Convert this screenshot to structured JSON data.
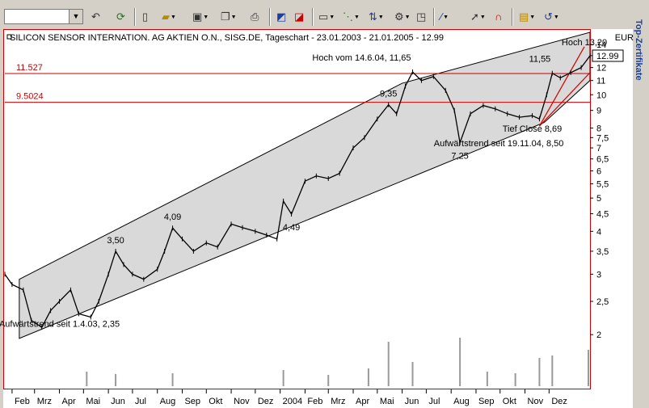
{
  "toolbar": {
    "symbol_value": "",
    "icons": [
      "back-icon",
      "refresh-icon",
      "new-document-icon",
      "open-folder-icon",
      "save-icon",
      "copy-icon",
      "print-icon",
      "chart-link-icon",
      "chart-export-icon",
      "window-icon",
      "indicator-icon",
      "compare-icon",
      "settings-icon",
      "line-tool-icon",
      "cursor-icon",
      "magnet-icon",
      "info-icon",
      "undo-icon"
    ]
  },
  "side_tab": {
    "label": "Top-Zertifikate"
  },
  "chart_data": {
    "type": "line",
    "title": "SILICON SENSOR INTERNATION. AG AKTIEN O.N., SISG.DE, Tageschart - 23.01.2003 - 21.01.2005 - 12.99",
    "currency": "EUR",
    "last_price_label": "12.99",
    "y_scale": "log",
    "ylim": [
      1.4,
      15.2
    ],
    "y_ticks": [
      "14",
      "13",
      "12",
      "11",
      "10",
      "9",
      "8",
      "7,5",
      "7",
      "6,5",
      "6",
      "5,5",
      "5",
      "4,5",
      "4",
      "3,5",
      "3",
      "2,5",
      "2"
    ],
    "x_range": [
      "2003-01-23",
      "2005-01-21"
    ],
    "x_tick_labels": [
      {
        "date": "2003-02-01",
        "label": "Feb"
      },
      {
        "date": "2003-03-01",
        "label": "Mrz"
      },
      {
        "date": "2003-04-01",
        "label": "Apr"
      },
      {
        "date": "2003-05-01",
        "label": "Mai"
      },
      {
        "date": "2003-06-01",
        "label": "Jun"
      },
      {
        "date": "2003-07-01",
        "label": "Jul"
      },
      {
        "date": "2003-08-01",
        "label": "Aug"
      },
      {
        "date": "2003-09-01",
        "label": "Sep"
      },
      {
        "date": "2003-10-01",
        "label": "Okt"
      },
      {
        "date": "2003-11-01",
        "label": "Nov"
      },
      {
        "date": "2003-12-01",
        "label": "Dez"
      },
      {
        "date": "2004-01-01",
        "label": "2004"
      },
      {
        "date": "2004-02-01",
        "label": "Feb"
      },
      {
        "date": "2004-03-01",
        "label": "Mrz"
      },
      {
        "date": "2004-04-01",
        "label": "Apr"
      },
      {
        "date": "2004-05-01",
        "label": "Mai"
      },
      {
        "date": "2004-06-01",
        "label": "Jun"
      },
      {
        "date": "2004-07-01",
        "label": "Jul"
      },
      {
        "date": "2004-08-01",
        "label": "Aug"
      },
      {
        "date": "2004-09-01",
        "label": "Sep"
      },
      {
        "date": "2004-10-01",
        "label": "Okt"
      },
      {
        "date": "2004-11-01",
        "label": "Nov"
      },
      {
        "date": "2004-12-01",
        "label": "Dez"
      }
    ],
    "horizontal_lines": [
      {
        "value": 11.527,
        "label": "11.527",
        "color": "#cc0000"
      },
      {
        "value": 9.5024,
        "label": "9.5024",
        "color": "#cc0000"
      }
    ],
    "trend_channel": {
      "lower": [
        {
          "date": "2003-02-10",
          "value": 1.95
        },
        {
          "date": "2004-11-25",
          "value": 8.3
        },
        {
          "date": "2005-01-21",
          "value": 11.0
        }
      ],
      "upper": [
        {
          "date": "2003-02-10",
          "value": 2.9
        },
        {
          "date": "2004-06-01",
          "value": 10.8
        },
        {
          "date": "2005-01-21",
          "value": 15.2
        }
      ],
      "fill": "#d9d9d9"
    },
    "red_trend_lines": [
      {
        "from": {
          "date": "2004-11-19",
          "value": 8.1
        },
        "to": {
          "date": "2005-01-14",
          "value": 13.8
        }
      },
      {
        "from": {
          "date": "2004-11-19",
          "value": 8.1
        },
        "to": {
          "date": "2005-01-21",
          "value": 11.6
        }
      }
    ],
    "series": [
      {
        "color": "#000000",
        "points": [
          {
            "date": "2003-01-23",
            "value": 3.0
          },
          {
            "date": "2003-02-01",
            "value": 2.8
          },
          {
            "date": "2003-02-15",
            "value": 2.7
          },
          {
            "date": "2003-02-25",
            "value": 2.2
          },
          {
            "date": "2003-03-10",
            "value": 2.1
          },
          {
            "date": "2003-03-21",
            "value": 2.35
          },
          {
            "date": "2003-04-01",
            "value": 2.5
          },
          {
            "date": "2003-04-15",
            "value": 2.7
          },
          {
            "date": "2003-04-25",
            "value": 2.3
          },
          {
            "date": "2003-05-10",
            "value": 2.25
          },
          {
            "date": "2003-05-20",
            "value": 2.5
          },
          {
            "date": "2003-06-01",
            "value": 3.0
          },
          {
            "date": "2003-06-10",
            "value": 3.5
          },
          {
            "date": "2003-06-20",
            "value": 3.2
          },
          {
            "date": "2003-07-01",
            "value": 3.0
          },
          {
            "date": "2003-07-15",
            "value": 2.9
          },
          {
            "date": "2003-08-01",
            "value": 3.1
          },
          {
            "date": "2003-08-10",
            "value": 3.5
          },
          {
            "date": "2003-08-20",
            "value": 4.09
          },
          {
            "date": "2003-09-01",
            "value": 3.8
          },
          {
            "date": "2003-09-15",
            "value": 3.5
          },
          {
            "date": "2003-10-01",
            "value": 3.7
          },
          {
            "date": "2003-10-15",
            "value": 3.6
          },
          {
            "date": "2003-11-01",
            "value": 4.2
          },
          {
            "date": "2003-11-15",
            "value": 4.1
          },
          {
            "date": "2003-12-01",
            "value": 4.0
          },
          {
            "date": "2003-12-15",
            "value": 3.9
          },
          {
            "date": "2003-12-28",
            "value": 3.8
          },
          {
            "date": "2004-01-05",
            "value": 4.9
          },
          {
            "date": "2004-01-15",
            "value": 4.49
          },
          {
            "date": "2004-02-01",
            "value": 5.6
          },
          {
            "date": "2004-02-15",
            "value": 5.8
          },
          {
            "date": "2004-03-01",
            "value": 5.7
          },
          {
            "date": "2004-03-15",
            "value": 5.9
          },
          {
            "date": "2004-04-01",
            "value": 7.0
          },
          {
            "date": "2004-04-15",
            "value": 7.5
          },
          {
            "date": "2004-05-01",
            "value": 8.5
          },
          {
            "date": "2004-05-15",
            "value": 9.35
          },
          {
            "date": "2004-05-25",
            "value": 8.8
          },
          {
            "date": "2004-06-05",
            "value": 10.6
          },
          {
            "date": "2004-06-14",
            "value": 11.65
          },
          {
            "date": "2004-06-25",
            "value": 11.0
          },
          {
            "date": "2004-07-10",
            "value": 11.3
          },
          {
            "date": "2004-07-25",
            "value": 10.3
          },
          {
            "date": "2004-08-05",
            "value": 9.0
          },
          {
            "date": "2004-08-12",
            "value": 7.25
          },
          {
            "date": "2004-08-25",
            "value": 8.8
          },
          {
            "date": "2004-09-10",
            "value": 9.3
          },
          {
            "date": "2004-09-25",
            "value": 9.1
          },
          {
            "date": "2004-10-10",
            "value": 8.8
          },
          {
            "date": "2004-10-25",
            "value": 8.6
          },
          {
            "date": "2004-11-10",
            "value": 8.69
          },
          {
            "date": "2004-11-19",
            "value": 8.5
          },
          {
            "date": "2004-11-28",
            "value": 10.0
          },
          {
            "date": "2004-12-05",
            "value": 11.55
          },
          {
            "date": "2004-12-15",
            "value": 11.2
          },
          {
            "date": "2004-12-28",
            "value": 11.6
          },
          {
            "date": "2005-01-10",
            "value": 12.0
          },
          {
            "date": "2005-01-21",
            "value": 12.99
          }
        ]
      }
    ],
    "volume": {
      "color": "#9a9a9a",
      "bars": [
        {
          "date": "2003-05-05",
          "rel": 0.18
        },
        {
          "date": "2003-06-10",
          "rel": 0.15
        },
        {
          "date": "2003-08-20",
          "rel": 0.16
        },
        {
          "date": "2004-01-05",
          "rel": 0.2
        },
        {
          "date": "2004-03-01",
          "rel": 0.14
        },
        {
          "date": "2004-04-20",
          "rel": 0.22
        },
        {
          "date": "2004-05-15",
          "rel": 0.55
        },
        {
          "date": "2004-06-14",
          "rel": 0.3
        },
        {
          "date": "2004-08-12",
          "rel": 0.6
        },
        {
          "date": "2004-09-15",
          "rel": 0.18
        },
        {
          "date": "2004-10-20",
          "rel": 0.16
        },
        {
          "date": "2004-11-19",
          "rel": 0.35
        },
        {
          "date": "2004-12-05",
          "rel": 0.38
        },
        {
          "date": "2005-01-19",
          "rel": 0.45
        }
      ]
    },
    "annotations": [
      {
        "text": "3,50",
        "date": "2003-06-10",
        "value": 3.5,
        "pos": "above"
      },
      {
        "text": "4,09",
        "date": "2003-08-20",
        "value": 4.09,
        "pos": "above"
      },
      {
        "text": "4,49",
        "date": "2004-01-15",
        "value": 4.49,
        "pos": "below"
      },
      {
        "text": "9,35",
        "date": "2004-05-15",
        "value": 9.35,
        "pos": "above"
      },
      {
        "text": "Hoch vom 14.6.04, 11,65",
        "date": "2004-06-14",
        "value": 11.65,
        "pos": "above-left"
      },
      {
        "text": "7,25",
        "date": "2004-08-12",
        "value": 7.25,
        "pos": "below"
      },
      {
        "text": "Tief Close 8,69",
        "date": "2004-11-10",
        "value": 8.69,
        "pos": "below"
      },
      {
        "text": "Aufwärtstrend seit 19.11.04, 8,50",
        "date": "2004-11-19",
        "value": 8.5,
        "pos": "below-left"
      },
      {
        "text": "11,55",
        "date": "2004-12-05",
        "value": 11.55,
        "pos": "above-left"
      },
      {
        "text": "Hoch 13,20",
        "date": "2005-01-14",
        "value": 13.2,
        "pos": "above"
      },
      {
        "text": "Aufwärtstrend seit 1.4.03, 2,35",
        "date": "2003-04-01",
        "value": 2.35,
        "pos": "below"
      }
    ]
  }
}
